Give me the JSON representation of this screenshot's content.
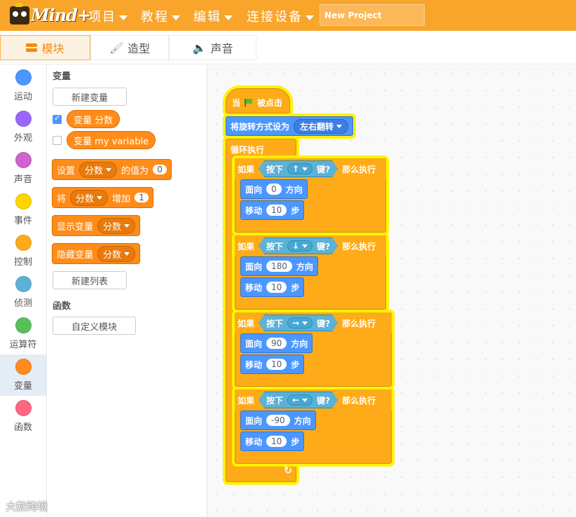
{
  "app": {
    "logo_text": "Mind+"
  },
  "menu": [
    {
      "label": "项目"
    },
    {
      "label": "教程"
    },
    {
      "label": "编辑"
    },
    {
      "label": "连接设备"
    }
  ],
  "project": {
    "title": "New Project"
  },
  "tabs": [
    {
      "label": "模块",
      "icon": "blocks-icon",
      "active": true
    },
    {
      "label": "造型",
      "icon": "brush-icon",
      "active": false
    },
    {
      "label": "声音",
      "icon": "speaker-icon",
      "active": false
    }
  ],
  "categories": [
    {
      "label": "运动",
      "color": "#4c97ff"
    },
    {
      "label": "外观",
      "color": "#9966ff"
    },
    {
      "label": "声音",
      "color": "#cf63cf"
    },
    {
      "label": "事件",
      "color": "#ffd500"
    },
    {
      "label": "控制",
      "color": "#ffab19"
    },
    {
      "label": "侦测",
      "color": "#5cb1d6"
    },
    {
      "label": "运算符",
      "color": "#59c059"
    },
    {
      "label": "变量",
      "color": "#ff8c1a"
    },
    {
      "label": "函数",
      "color": "#ff6680"
    }
  ],
  "active_category": "变量",
  "palette": {
    "variables_title": "变量",
    "new_variable_button": "新建变量",
    "var_items": [
      {
        "label": "变量 分数",
        "checked": true
      },
      {
        "label": "变量 my variable",
        "checked": false
      }
    ],
    "set_block": {
      "text1": "设置",
      "var": "分数",
      "text2": "的值为",
      "value": "0"
    },
    "change_block": {
      "text1": "将",
      "var": "分数",
      "text2": "增加",
      "value": "1"
    },
    "show_block": {
      "text1": "显示变量",
      "var": "分数"
    },
    "hide_block": {
      "text1": "隐藏变量",
      "var": "分数"
    },
    "new_list_button": "新建列表",
    "functions_title": "函数",
    "custom_block_button": "自定义模块"
  },
  "script": {
    "hat_text1": "当",
    "hat_text2": "被点击",
    "rotation_block": {
      "text": "将旋转方式设为",
      "value": "左右翻转"
    },
    "forever_label": "循环执行",
    "if_label": "如果",
    "then_label": "那么执行",
    "press_label": "按下",
    "key_label": "键?",
    "face_label": "面向",
    "direction_label": "方向",
    "move_label": "移动",
    "steps_label": "步",
    "ifs": [
      {
        "key": "↑",
        "direction": "0",
        "steps": "10"
      },
      {
        "key": "↓",
        "direction": "180",
        "steps": "10"
      },
      {
        "key": "→",
        "direction": "90",
        "steps": "10"
      },
      {
        "key": "←",
        "direction": "-90",
        "steps": "10"
      }
    ],
    "loop_arrow": "↻"
  },
  "watermark": "大數跨境"
}
